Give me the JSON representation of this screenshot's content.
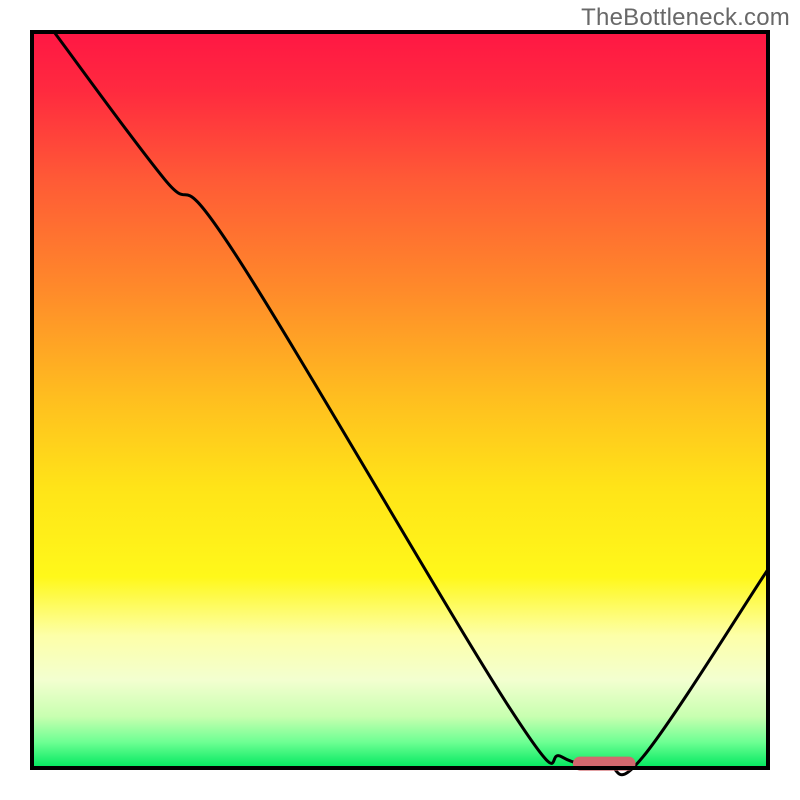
{
  "watermark": "TheBottleneck.com",
  "chart_data": {
    "type": "line",
    "title": "",
    "xlabel": "",
    "ylabel": "",
    "x_range": [
      0,
      100
    ],
    "y_range": [
      0,
      100
    ],
    "gradient_stops": [
      {
        "offset": 0.0,
        "color": "#ff1744"
      },
      {
        "offset": 0.08,
        "color": "#ff2a3f"
      },
      {
        "offset": 0.2,
        "color": "#ff5a36"
      },
      {
        "offset": 0.35,
        "color": "#ff8a2a"
      },
      {
        "offset": 0.5,
        "color": "#ffbf1f"
      },
      {
        "offset": 0.62,
        "color": "#ffe418"
      },
      {
        "offset": 0.74,
        "color": "#fff81a"
      },
      {
        "offset": 0.82,
        "color": "#fdffa8"
      },
      {
        "offset": 0.88,
        "color": "#f3ffd0"
      },
      {
        "offset": 0.93,
        "color": "#c8ffb0"
      },
      {
        "offset": 0.965,
        "color": "#6dff93"
      },
      {
        "offset": 1.0,
        "color": "#00e85e"
      }
    ],
    "series": [
      {
        "name": "bottleneck-curve",
        "points": [
          {
            "x": 3.0,
            "y": 100.0
          },
          {
            "x": 18.0,
            "y": 80.0
          },
          {
            "x": 27.5,
            "y": 70.0
          },
          {
            "x": 65.0,
            "y": 8.0
          },
          {
            "x": 72.0,
            "y": 1.5
          },
          {
            "x": 78.0,
            "y": 0.5
          },
          {
            "x": 83.0,
            "y": 1.5
          },
          {
            "x": 100.0,
            "y": 27.0
          }
        ]
      }
    ],
    "marker": {
      "name": "optimal-range",
      "x_start": 73.5,
      "x_end": 82.0,
      "y": 0.6,
      "color": "#d1696e"
    },
    "frame": {
      "stroke": "#000000",
      "stroke_width": 4
    }
  }
}
